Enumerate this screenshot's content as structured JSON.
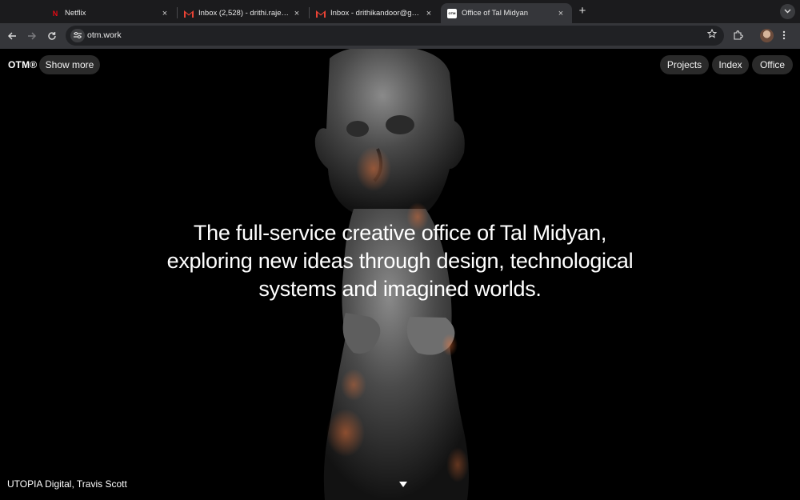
{
  "browser": {
    "tabs": [
      {
        "title": "Netflix",
        "favicon": "netflix-icon",
        "active": false
      },
      {
        "title": "Inbox (2,528) - drithi.rajesh@",
        "favicon": "gmail-icon",
        "active": false
      },
      {
        "title": "Inbox - drithikandoor@gmail.c",
        "favicon": "gmail-icon",
        "active": false
      },
      {
        "title": "Office of Tal Midyan",
        "favicon": "otm-icon",
        "active": true
      }
    ],
    "favicon_text": {
      "netflix": "N",
      "gmail": "M",
      "otm": "OTM"
    },
    "close_glyph": "×",
    "new_tab_glyph": "+",
    "url": "otm.work"
  },
  "site": {
    "logo": "OTM®",
    "show_more": "Show more",
    "nav": [
      "Projects",
      "Index",
      "Office"
    ],
    "headline_lines": [
      "The full-service creative office of Tal Midyan,",
      "exploring new ideas through design, technological",
      "systems and imagined worlds."
    ],
    "credit": "UTOPIA Digital, Travis Scott"
  },
  "colors": {
    "page_bg": "#000000",
    "pill_bg": "#2a2a2a",
    "text": "#ffffff",
    "netflix_red": "#e50914"
  }
}
